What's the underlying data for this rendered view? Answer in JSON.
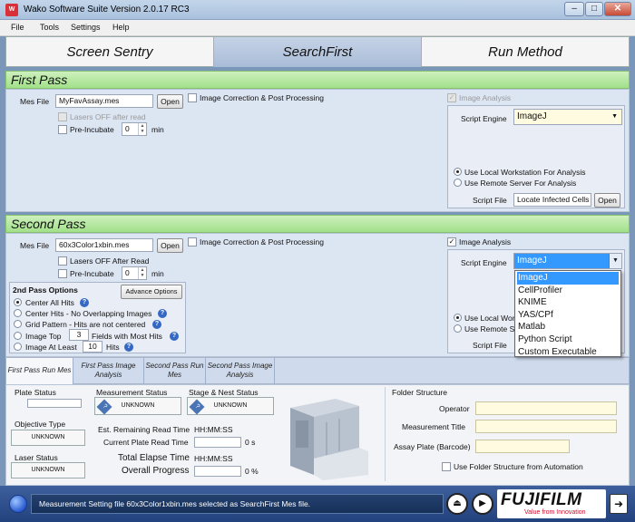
{
  "window": {
    "title": "Wako Software Suite Version 2.0.17 RC3",
    "min": "–",
    "max": "□",
    "close": "✕"
  },
  "menu": [
    "File",
    "Tools",
    "Settings",
    "Help"
  ],
  "main_tabs": [
    "Screen Sentry",
    "SearchFirst",
    "Run Method"
  ],
  "first_pass": {
    "header": "First Pass",
    "mes_file_label": "Mes File",
    "mes_file": "MyFavAssay.mes",
    "open": "Open",
    "image_correction": "Image Correction & Post Processing",
    "lasers_off": "Lasers OFF after read",
    "pre_incubate": "Pre-Incubate",
    "pre_incubate_value": "0",
    "min": "min",
    "image_analysis": "Image Analysis",
    "script_engine_label": "Script Engine",
    "script_engine": "ImageJ",
    "local": "Use Local Workstation For Analysis",
    "remote": "Use Remote Server For Analysis",
    "script_file_label": "Script File",
    "script_file": "Locate Infected Cells",
    "script_open": "Open"
  },
  "second_pass": {
    "header": "Second Pass",
    "mes_file_label": "Mes File",
    "mes_file": "60x3Color1xbin.mes",
    "open": "Open",
    "image_correction": "Image Correction & Post Processing",
    "lasers_off": "Lasers OFF After Read",
    "pre_incubate": "Pre-Incubate",
    "pre_incubate_value": "0",
    "min": "min",
    "image_analysis": "Image Analysis",
    "script_engine_label": "Script Engine",
    "script_engine": "ImageJ",
    "local": "Use Local Wor",
    "remote": "Use Remote Se",
    "script_file_label": "Script File"
  },
  "options": {
    "title": "2nd Pass Options",
    "advanced": "Advance Options",
    "center_all": "Center All Hits",
    "center_hits": "Center Hits - No Overlapping Images",
    "grid": "Grid Pattern - Hits are not centered",
    "image_top": "Image Top",
    "image_top_value": "3",
    "fields": "Fields with Most Hits",
    "at_least": "Image At Least",
    "at_least_value": "10",
    "hits": "Hits",
    "help": "?"
  },
  "engine_options": [
    "ImageJ",
    "CellProfiler",
    "KNIME",
    "YAS/CPf",
    "Matlab",
    "Python Script",
    "Custom Executable"
  ],
  "sub_tabs": [
    [
      "First Pass Run Mes",
      ""
    ],
    [
      "First Pass Image",
      "Analysis"
    ],
    [
      "Second Pass Run",
      "Mes"
    ],
    [
      "Second Pass Image",
      "Analysis"
    ]
  ],
  "status": {
    "plate_status": "Plate Status",
    "measurement_status": "Measurement Status",
    "stage_status": "Stage & Nest Status",
    "unknown": "UNKNOWN",
    "objective_type": "Objective Type",
    "laser_status": "Laser Status",
    "est_remaining": "Est. Remaining Read Time",
    "current_plate": "Current Plate Read Time",
    "total_elapse": "Total Elapse Time",
    "overall": "Overall Progress",
    "hhmmss": "HH:MM:SS",
    "zero_s": "0 s",
    "zero_pct": "0 %"
  },
  "folder": {
    "title": "Folder Structure",
    "operator": "Operator",
    "measurement_title": "Measurement Title",
    "assay_plate": "Assay Plate (Barcode)",
    "use_folder": "Use Folder Structure from Automation"
  },
  "statusbar": {
    "message": "Measurement Setting file 60x3Color1xbin.mes selected as SearchFirst Mes file.",
    "eject": "⏏",
    "play": "▶",
    "exit": "➜"
  },
  "logo": {
    "brand": "FUJIFILM",
    "tagline": "Value from Innovation"
  },
  "colors": {
    "pass_header": "#a2e08a",
    "statusbar": "#22427e",
    "selected": "#3399ff"
  }
}
